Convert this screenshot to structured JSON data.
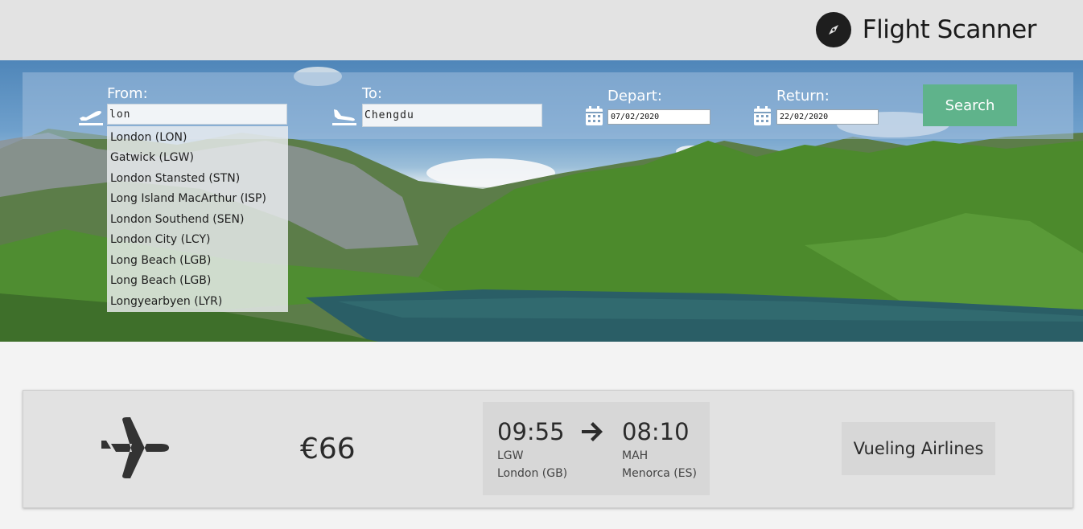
{
  "header": {
    "title": "Flight Scanner",
    "logo_icon": "compass-icon"
  },
  "search": {
    "from_label": "From:",
    "from_value": "lon",
    "to_label": "To:",
    "to_value": "Chengdu",
    "depart_label": "Depart:",
    "depart_value": "07/02/2020",
    "return_label": "Return:",
    "return_value": "22/02/2020",
    "search_button": "Search"
  },
  "autocomplete": [
    "London (LON)",
    "Gatwick (LGW)",
    "London Stansted (STN)",
    "Long Island MacArthur (ISP)",
    "London Southend (SEN)",
    "London City (LCY)",
    "Long Beach (LGB)",
    "Long Beach (LGB)",
    "Longyearbyen (LYR)"
  ],
  "result": {
    "price": "€66",
    "depart_time": "09:55",
    "depart_code": "LGW",
    "depart_city": "London (GB)",
    "arrive_time": "08:10",
    "arrive_code": "MAH",
    "arrive_city": "Menorca (ES)",
    "airline": "Vueling Airlines"
  },
  "colors": {
    "accent": "#5fb38b",
    "topbar": "#e3e3e3",
    "card": "#e2e2e2"
  }
}
